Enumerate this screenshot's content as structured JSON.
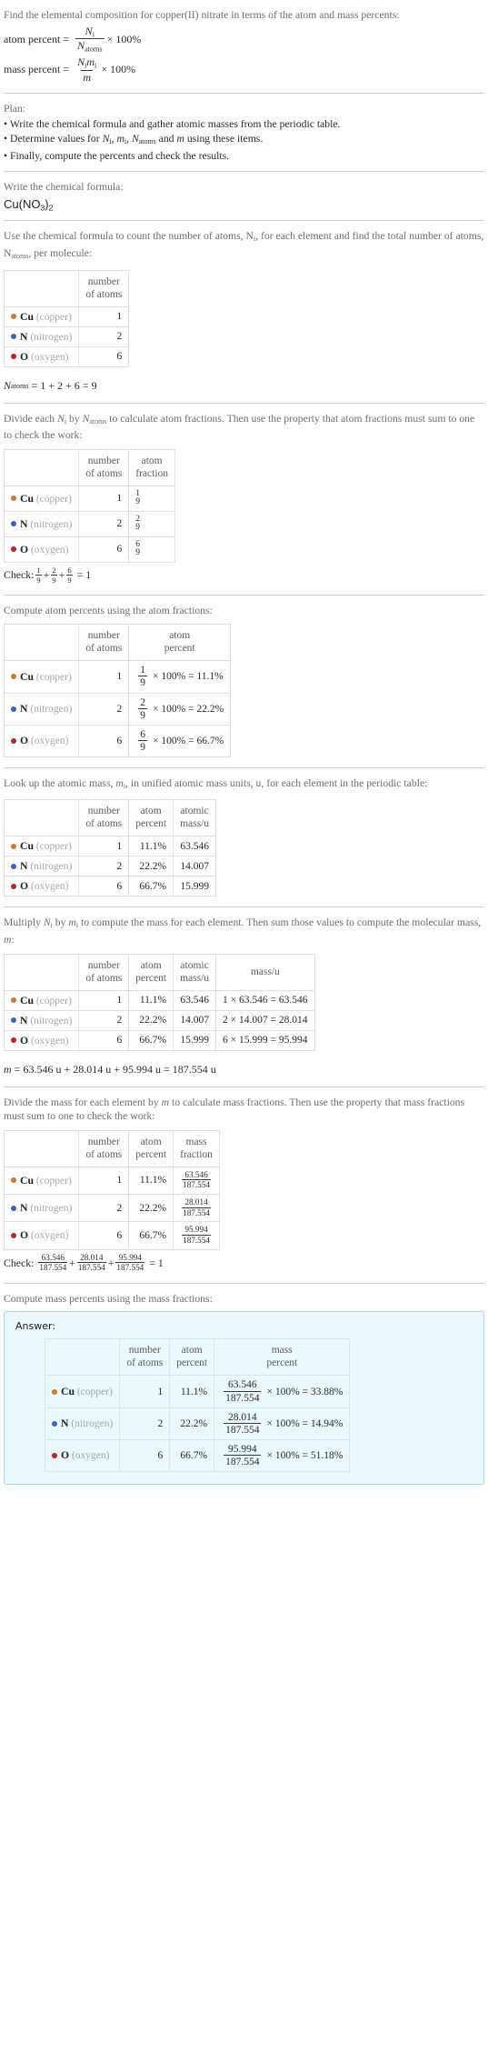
{
  "intro": {
    "question": "Find the elemental composition for copper(II) nitrate in terms of the atom and mass percents:",
    "atom_percent_label": "atom percent =",
    "atom_percent_num": "N",
    "atom_percent_num_sub": "i",
    "atom_percent_den": "N",
    "atom_percent_den_sub": "atoms",
    "atom_percent_tail": "× 100%",
    "mass_percent_label": "mass percent =",
    "mass_percent_num": "N",
    "mass_percent_num_sub": "i",
    "mass_percent_num2": "m",
    "mass_percent_num2_sub": "i",
    "mass_percent_den": "m",
    "mass_percent_tail": "× 100%"
  },
  "plan": {
    "heading": "Plan:",
    "bullet1": "• Write the chemical formula and gather atomic masses from the periodic table.",
    "bullet2_a": "• Determine values for ",
    "bullet2_b": " using these items.",
    "bullet3": "• Finally, compute the percents and check the results."
  },
  "formula_step": {
    "prompt": "Write the chemical formula:",
    "formula_parts": [
      "Cu(NO",
      "3",
      ")",
      "2"
    ],
    "formula_plain": "Cu(NO3)2"
  },
  "count_step": {
    "prompt_line1": "Use the chemical formula to count the number of atoms, N",
    "prompt_sub1": "i",
    "prompt_line2": ", for each element and find the total number of atoms, N",
    "prompt_sub2": "atoms",
    "prompt_line3": ", per molecule:",
    "headers": [
      "",
      "number of atoms"
    ],
    "total_label": "N",
    "total_sub": "atoms",
    "total_expr": "= 1 + 2 + 6 = 9"
  },
  "fraction_step": {
    "prompt": "Divide each Ni by Natoms to calculate atom fractions. Then use the property that atom fractions must sum to one to check the work:",
    "prompt_a": "Divide each ",
    "prompt_b": " by ",
    "prompt_c": " to calculate atom fractions. Then use the property that atom fractions must sum to one to check the work:",
    "headers": [
      "",
      "number of atoms",
      "atom fraction"
    ],
    "check_label": "Check:",
    "check_result": "= 1"
  },
  "atom_percent_step": {
    "prompt": "Compute atom percents using the atom fractions:",
    "headers": [
      "",
      "number of atoms",
      "atom percent"
    ],
    "times": "× 100% ="
  },
  "atomic_mass_step": {
    "prompt_a": "Look up the atomic mass, ",
    "prompt_b": ", in unified atomic mass units, u, for each element in the periodic table:",
    "headers": [
      "",
      "number of atoms",
      "atom percent",
      "atomic mass/u"
    ]
  },
  "mass_step": {
    "prompt_a": "Multiply ",
    "prompt_b": " by ",
    "prompt_c": " to compute the mass for each element. Then sum those values to compute the molecular mass, ",
    "prompt_d": ":",
    "headers": [
      "",
      "number of atoms",
      "atom percent",
      "atomic mass/u",
      "mass/u"
    ],
    "sum_label": "m",
    "sum_expr": "= 63.546 u + 28.014 u + 95.994 u = 187.554 u"
  },
  "mass_fraction_step": {
    "prompt_a": "Divide the mass for each element by ",
    "prompt_b": " to calculate mass fractions. Then use the property that mass fractions must sum to one to check the work:",
    "headers": [
      "",
      "number of atoms",
      "atom percent",
      "mass fraction"
    ],
    "check_label": "Check:",
    "check_result": "= 1"
  },
  "mass_percent_step": {
    "prompt": "Compute mass percents using the mass fractions:",
    "answer_label": "Answer:",
    "headers": [
      "",
      "number of atoms",
      "atom percent",
      "mass percent"
    ],
    "times": "× 100% ="
  },
  "elements": [
    {
      "symbol": "Cu",
      "name": "(copper)",
      "color": "#c87b28",
      "atoms": "1",
      "atom_fraction_num": "1",
      "atom_fraction_den": "9",
      "atom_percent": "11.1%",
      "atomic_mass": "63.546",
      "mass_expr": "1 × 63.546 = 63.546",
      "mass": "63.546",
      "mass_fraction_num": "63.546",
      "mass_fraction_den": "187.554",
      "mass_percent": "33.88%"
    },
    {
      "symbol": "N",
      "name": "(nitrogen)",
      "color": "#3a5fcd",
      "atoms": "2",
      "atom_fraction_num": "2",
      "atom_fraction_den": "9",
      "atom_percent": "22.2%",
      "atomic_mass": "14.007",
      "mass_expr": "2 × 14.007 = 28.014",
      "mass": "28.014",
      "mass_fraction_num": "28.014",
      "mass_fraction_den": "187.554",
      "mass_percent": "14.94%"
    },
    {
      "symbol": "O",
      "name": "(oxygen)",
      "color": "#c22222",
      "atoms": "6",
      "atom_fraction_num": "6",
      "atom_fraction_den": "9",
      "atom_percent": "66.7%",
      "atomic_mass": "15.999",
      "mass_expr": "6 × 15.999 = 95.994",
      "mass": "95.994",
      "mass_fraction_num": "95.994",
      "mass_fraction_den": "187.554",
      "mass_percent": "51.18%"
    }
  ],
  "symbols": {
    "Ni": "N",
    "Ni_sub": "i",
    "mi": "m",
    "mi_sub": "i",
    "Natoms": "N",
    "Natoms_sub": "atoms",
    "m": "m",
    "plus": "+",
    "times": "×",
    "equals": "=",
    "pct100": "100%"
  }
}
